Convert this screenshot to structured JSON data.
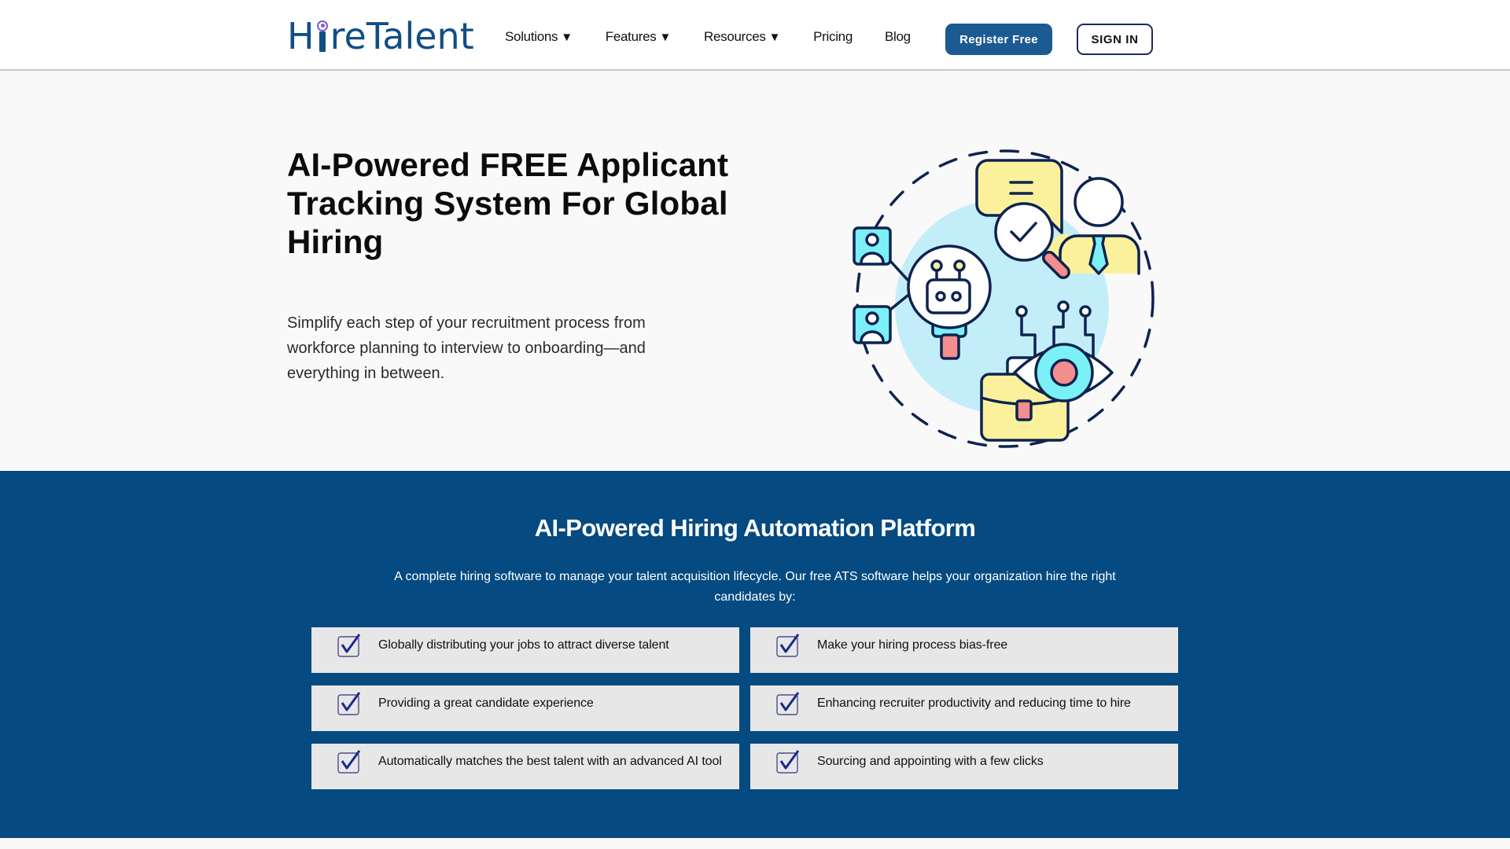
{
  "header": {
    "logo": {
      "part1": "H",
      "part2": "reTalent",
      "icon": "magnifier-person-icon"
    },
    "nav": [
      {
        "label": "Solutions",
        "has_dropdown": true
      },
      {
        "label": "Features",
        "has_dropdown": true
      },
      {
        "label": "Resources",
        "has_dropdown": true
      },
      {
        "label": "Pricing",
        "has_dropdown": false
      },
      {
        "label": "Blog",
        "has_dropdown": false
      }
    ],
    "dropdown_caret": "▼",
    "register_label": "Register Free",
    "signin_label": "SIGN IN"
  },
  "hero": {
    "title": "AI-Powered FREE Applicant Tracking System For Global Hiring",
    "subtitle": "Simplify each step of your recruitment process from workforce planning to interview to onboarding—and everything in between.",
    "illustration": "ai-recruitment-illustration"
  },
  "banner": {
    "title": "AI-Powered Hiring Automation Platform",
    "description": "A complete hiring software to manage your talent acquisition lifecycle. Our free ATS software helps your organization hire the right candidates by:",
    "features": [
      {
        "text": "Globally distributing your jobs to attract diverse talent",
        "icon": "checkbox-checked-icon"
      },
      {
        "text": "Make your hiring process bias-free",
        "icon": "checkbox-checked-icon"
      },
      {
        "text": "Providing a great candidate experience",
        "icon": "checkbox-checked-icon"
      },
      {
        "text": "Enhancing recruiter productivity and reducing time to hire",
        "icon": "checkbox-checked-icon"
      },
      {
        "text": "Automatically matches the best talent with an advanced AI tool",
        "icon": "checkbox-checked-icon"
      },
      {
        "text": "Sourcing and appointing with a few clicks",
        "icon": "checkbox-checked-icon"
      }
    ]
  },
  "colors": {
    "brand": "#124e86",
    "register_button": "#1c5a92",
    "banner_bg": "#054a80",
    "card_bg": "#e8e7e8",
    "hero_bg": "#f9f9f9",
    "illus_navy": "#0e2350",
    "illus_cyan": "#7cf0f7",
    "illus_light_blue": "#c3eef9",
    "illus_yellow": "#fbf19c",
    "illus_pink": "#f48d8d"
  }
}
